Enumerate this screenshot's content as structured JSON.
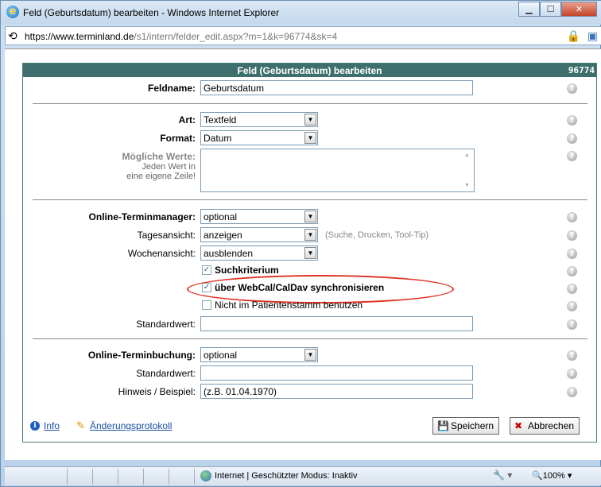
{
  "window": {
    "title": "Feld (Geburtsdatum) bearbeiten - Windows Internet Explorer",
    "url_host": "https://www.terminland.de",
    "url_path": "/s1/intern/felder_edit.aspx?m=1&k=96774&sk=4"
  },
  "panel": {
    "title": "Feld (Geburtsdatum) bearbeiten",
    "id": "96774"
  },
  "fields": {
    "feldname_label": "Feldname:",
    "feldname_value": "Geburtsdatum",
    "art_label": "Art:",
    "art_value": "Textfeld",
    "format_label": "Format:",
    "format_value": "Datum",
    "werte_label": "Mögliche Werte:",
    "werte_hint1": "Jeden Wert in",
    "werte_hint2": "eine eigene Zeile!",
    "otm_label": "Online-Terminmanager:",
    "otm_value": "optional",
    "tages_label": "Tagesansicht:",
    "tages_value": "anzeigen",
    "tages_hint": "(Suche, Drucken, Tool-Tip)",
    "wochen_label": "Wochenansicht:",
    "wochen_value": "ausblenden",
    "cb1": "Suchkriterium",
    "cb2": "über WebCal/CalDav synchronisieren",
    "cb3": "Nicht im Patientenstamm benutzen",
    "std1_label": "Standardwert:",
    "otb_label": "Online-Terminbuchung:",
    "otb_value": "optional",
    "std2_label": "Standardwert:",
    "hinweis_label": "Hinweis / Beispiel:",
    "hinweis_value": "(z.B. 01.04.1970)"
  },
  "footer": {
    "info": "Info",
    "protokoll": "Änderungsprotokoll",
    "save": "Speichern",
    "cancel": "Abbrechen"
  },
  "status": {
    "text": "Internet | Geschützter Modus: Inaktiv",
    "zoom": "100%"
  },
  "colors": {
    "header": "#3e6f6d",
    "highlight": "#d32222"
  }
}
